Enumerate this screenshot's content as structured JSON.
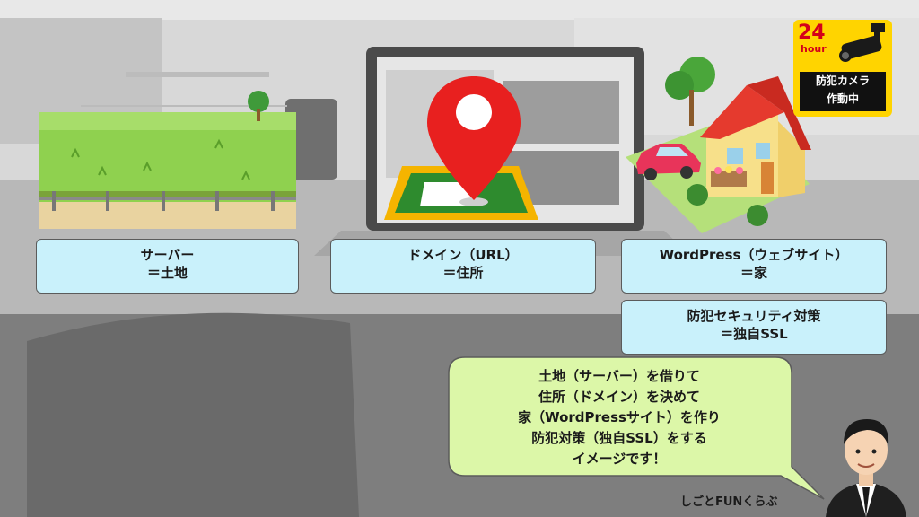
{
  "boxes": {
    "server": {
      "line1": "サーバー",
      "line2": "＝土地"
    },
    "domain": {
      "line1": "ドメイン（URL）",
      "line2": "＝住所"
    },
    "wordpress": {
      "line1": "WordPress（ウェブサイト）",
      "line2": "＝家"
    },
    "ssl": {
      "line1": "防犯セキュリティ対策",
      "line2": "＝独自SSL"
    }
  },
  "bubble": {
    "lines": [
      "土地（サーバー）を借りて",
      "住所（ドメイン）を決めて",
      "家（WordPressサイト）を作り",
      "防犯対策（独自SSL）をする",
      "イメージです！"
    ]
  },
  "sign": {
    "hours": "24",
    "hour_word": "hour",
    "line1": "防犯カメラ",
    "line2": "作動中"
  },
  "brand": "しごとFUNくらぶ",
  "icons": [
    "land-plot-illustration",
    "map-pin-icon",
    "house-illustration",
    "car-illustration",
    "security-camera-icon",
    "presenter-avatar"
  ],
  "colors": {
    "box_fill": "#c9f1fb",
    "bubble_fill": "#dcf7a8",
    "pin_red": "#e8201f",
    "sign_yellow": "#ffd400"
  }
}
